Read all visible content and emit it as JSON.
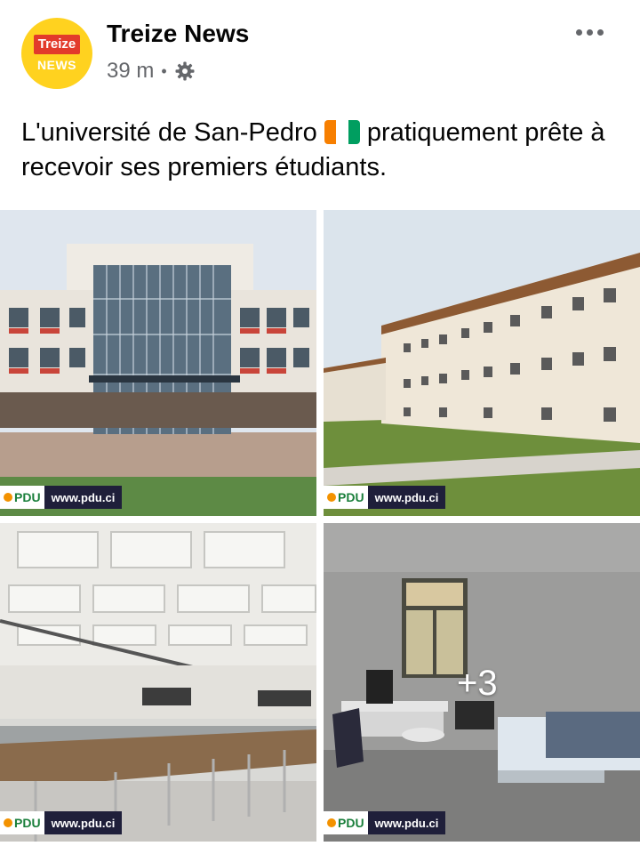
{
  "post": {
    "page_name": "Treize News",
    "avatar": {
      "line1": "Treize",
      "line2": "NEWS"
    },
    "time": "39 m",
    "separator": "•",
    "privacy_icon": "gear-icon",
    "more_icon": "more-dots-icon",
    "caption_before_flag": "L'université de San-Pedro ",
    "flag": "Côte d'Ivoire flag",
    "caption_after_flag": " pratiquement prête à recevoir ses premiers étudiants."
  },
  "photos": [
    {
      "watermark_logo": "PDU",
      "watermark_url": "www.pdu.ci"
    },
    {
      "watermark_logo": "PDU",
      "watermark_url": "www.pdu.ci"
    },
    {
      "watermark_logo": "PDU",
      "watermark_url": "www.pdu.ci"
    },
    {
      "watermark_logo": "PDU",
      "watermark_url": "www.pdu.ci",
      "more_count": "+3"
    }
  ],
  "colors": {
    "avatar_bg": "#ffd21f",
    "avatar_badge": "#e23a2b",
    "flag_orange": "#f77f00",
    "flag_white": "#ffffff",
    "flag_green": "#009e60",
    "secondary_text": "#65676b"
  }
}
